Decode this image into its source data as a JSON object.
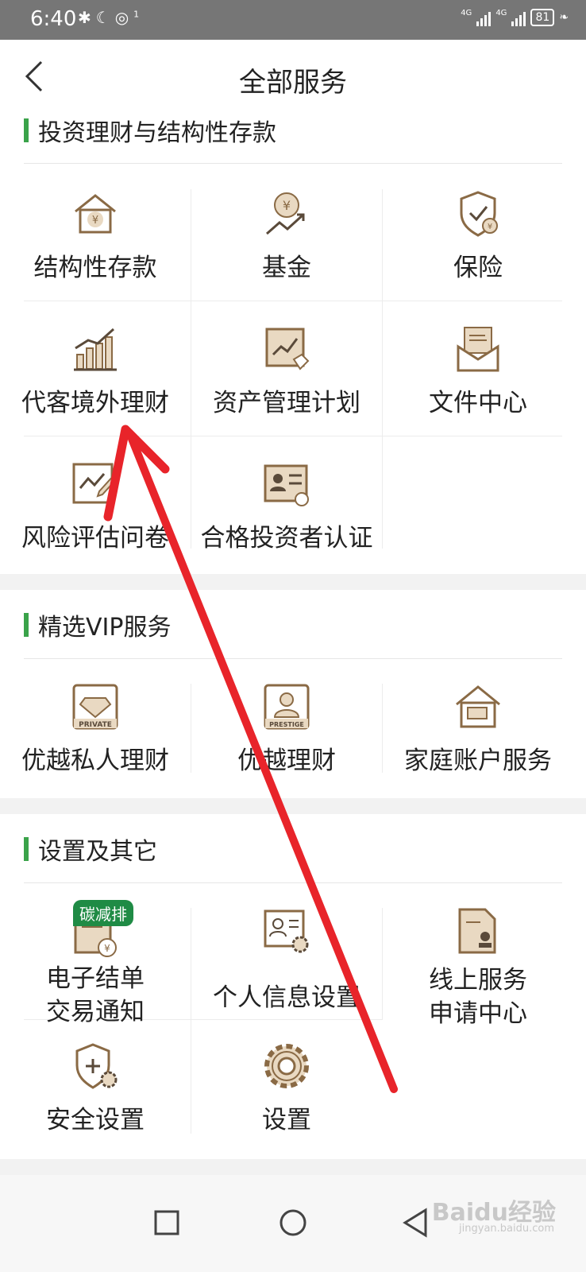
{
  "status_bar": {
    "time": "6:40",
    "notification_count": "1",
    "network_1": "4G",
    "network_2": "4G",
    "battery": "81"
  },
  "header": {
    "title": "全部服务"
  },
  "sections": [
    {
      "title": "投资理财与结构性存款",
      "items": [
        {
          "label": "结构性存款",
          "icon": "house-yen-icon"
        },
        {
          "label": "基金",
          "icon": "coin-trend-icon"
        },
        {
          "label": "保险",
          "icon": "shield-check-icon"
        },
        {
          "label": "代客境外理财",
          "icon": "bar-chart-trend-icon"
        },
        {
          "label": "资产管理计划",
          "icon": "chart-doc-icon"
        },
        {
          "label": "文件中心",
          "icon": "envelope-doc-icon"
        },
        {
          "label": "风险评估问卷",
          "icon": "chart-pencil-icon"
        },
        {
          "label": "合格投资者认证",
          "icon": "id-card-icon"
        }
      ]
    },
    {
      "title": "精选VIP服务",
      "items": [
        {
          "label": "优越私人理财",
          "icon": "private-diamond-icon",
          "tag": "PRIVATE"
        },
        {
          "label": "优越理财",
          "icon": "prestige-person-icon",
          "tag": "PRESTIGE"
        },
        {
          "label": "家庭账户服务",
          "icon": "house-card-icon"
        }
      ]
    },
    {
      "title": "设置及其它",
      "items": [
        {
          "label": "电子结单",
          "label2": "交易通知",
          "icon": "statement-yen-icon",
          "badge": "碳减排"
        },
        {
          "label": "个人信息设置",
          "icon": "profile-gear-icon"
        },
        {
          "label": "线上服务",
          "label2": "申请中心",
          "icon": "document-stamp-icon"
        },
        {
          "label": "安全设置",
          "icon": "shield-plus-gear-icon"
        },
        {
          "label": "设置",
          "icon": "gear-icon"
        }
      ]
    }
  ],
  "watermark": {
    "text": "Baidu经验",
    "sub": "jingyan.baidu.com"
  },
  "colors": {
    "accent_green": "#3aa34a",
    "icon_brown": "#8a6a45",
    "icon_fill": "#e9d9c2",
    "arrow_red": "#e8242a",
    "status_bar": "#767676"
  }
}
